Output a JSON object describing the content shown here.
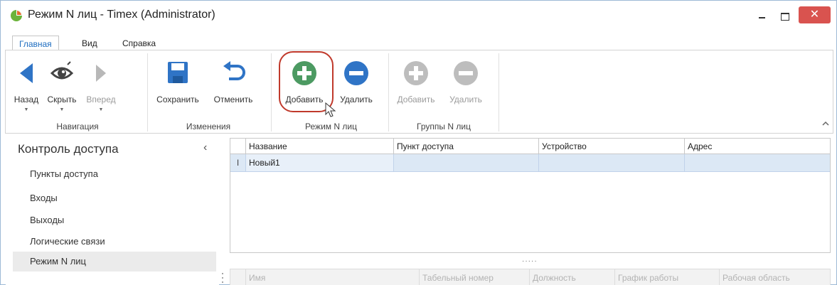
{
  "window": {
    "title": "Режим N лиц - Timex (Administrator)",
    "close_glyph": "✕"
  },
  "tabs": [
    {
      "label": "Главная",
      "active": true
    },
    {
      "label": "Вид",
      "active": false
    },
    {
      "label": "Справка",
      "active": false
    }
  ],
  "ribbon": {
    "groups": [
      {
        "label": "Навигация"
      },
      {
        "label": "Изменения"
      },
      {
        "label": "Режим N лиц"
      },
      {
        "label": "Группы N лиц"
      }
    ],
    "buttons": {
      "back": "Назад",
      "hide": "Скрыть",
      "forward": "Вперед",
      "save": "Сохранить",
      "cancel": "Отменить",
      "add": "Добавить",
      "delete": "Удалить",
      "group_add": "Добавить",
      "group_delete": "Удалить"
    },
    "dropdown_glyph": "▼"
  },
  "sidebar": {
    "title": "Контроль доступа",
    "collapse_glyph": "‹",
    "items": [
      {
        "label": "Пункты доступа",
        "selected": false
      },
      {
        "label": "Входы",
        "selected": false
      },
      {
        "label": "Выходы",
        "selected": false
      },
      {
        "label": "Логические связи",
        "selected": false
      },
      {
        "label": "Режим N лиц",
        "selected": true
      }
    ]
  },
  "grid": {
    "columns": [
      "Название",
      "Пункт доступа",
      "Устройство",
      "Адрес"
    ],
    "rows": [
      {
        "indicator": "I",
        "cells": [
          "Новый1",
          "",
          "",
          ""
        ]
      }
    ]
  },
  "splitter_glyph": "·····",
  "grid2": {
    "columns": [
      "Имя",
      "Табельный номер",
      "Должность",
      "График работы",
      "Рабочая область"
    ]
  },
  "colors": {
    "accent_blue": "#2f74c6",
    "add_green": "#4c9a62",
    "close_red": "#d9534f",
    "highlight_red": "#c0392b",
    "selected_row": "#dce8f5"
  }
}
